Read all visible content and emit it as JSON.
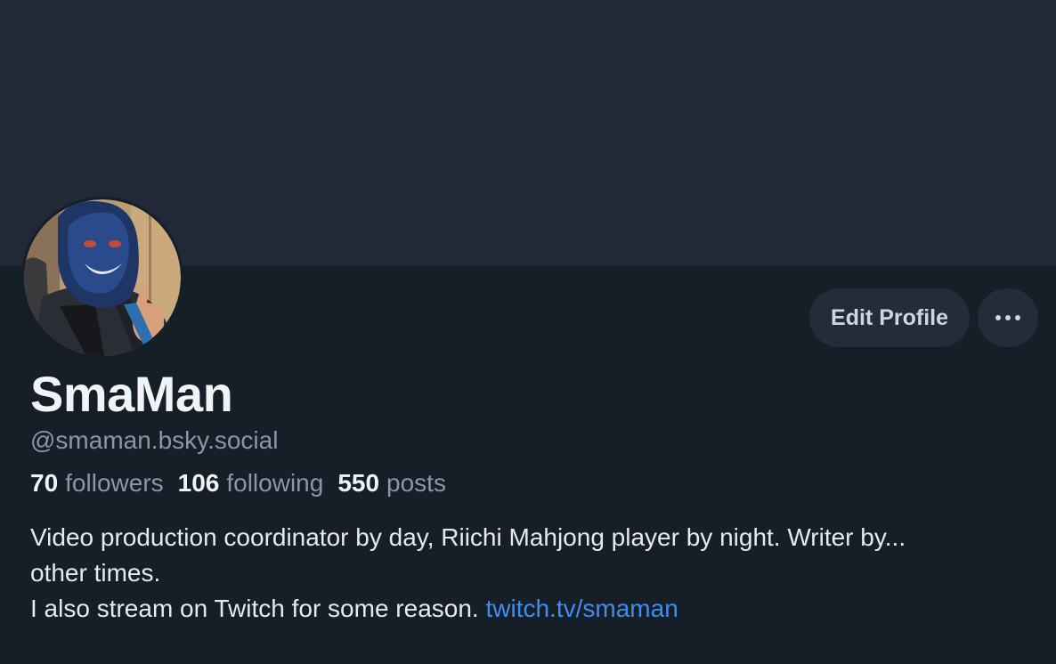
{
  "profile": {
    "display_name": "SmaMan",
    "handle": "@smaman.bsky.social",
    "stats": {
      "followers_count": "70",
      "followers_label": "followers",
      "following_count": "106",
      "following_label": "following",
      "posts_count": "550",
      "posts_label": "posts"
    },
    "bio": {
      "line1": "Video production coordinator by day, Riichi Mahjong player by night. Writer by...",
      "line2": "other times.",
      "line3": "I also stream on Twitch for some reason. ",
      "link": "twitch.tv/smaman"
    }
  },
  "actions": {
    "edit_profile_label": "Edit Profile",
    "more_icon": "ellipsis-icon"
  },
  "colors": {
    "background": "#161e27",
    "banner": "#212936",
    "button_bg": "#232d3a",
    "link": "#3e8ef0",
    "muted_text": "#8a97a8",
    "primary_text": "#f1f3f5"
  }
}
